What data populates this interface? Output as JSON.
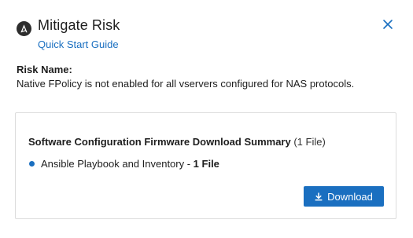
{
  "header": {
    "title": "Mitigate Risk",
    "guide_link": "Quick Start Guide",
    "logo_icon": "ansible-logo-icon",
    "close_icon": "close-icon"
  },
  "risk": {
    "label": "Risk Name:",
    "description": "Native FPolicy is not enabled for all vservers configured for NAS protocols."
  },
  "card": {
    "title": "Software Configuration Firmware Download Summary",
    "count": "(1 File)",
    "item_label": "Ansible Playbook and Inventory - ",
    "item_count": "1 File",
    "download_label": "Download",
    "download_icon": "download-icon"
  },
  "colors": {
    "accent": "#1a6fc0",
    "text": "#1e1e1e",
    "border": "#dcdcdc"
  }
}
